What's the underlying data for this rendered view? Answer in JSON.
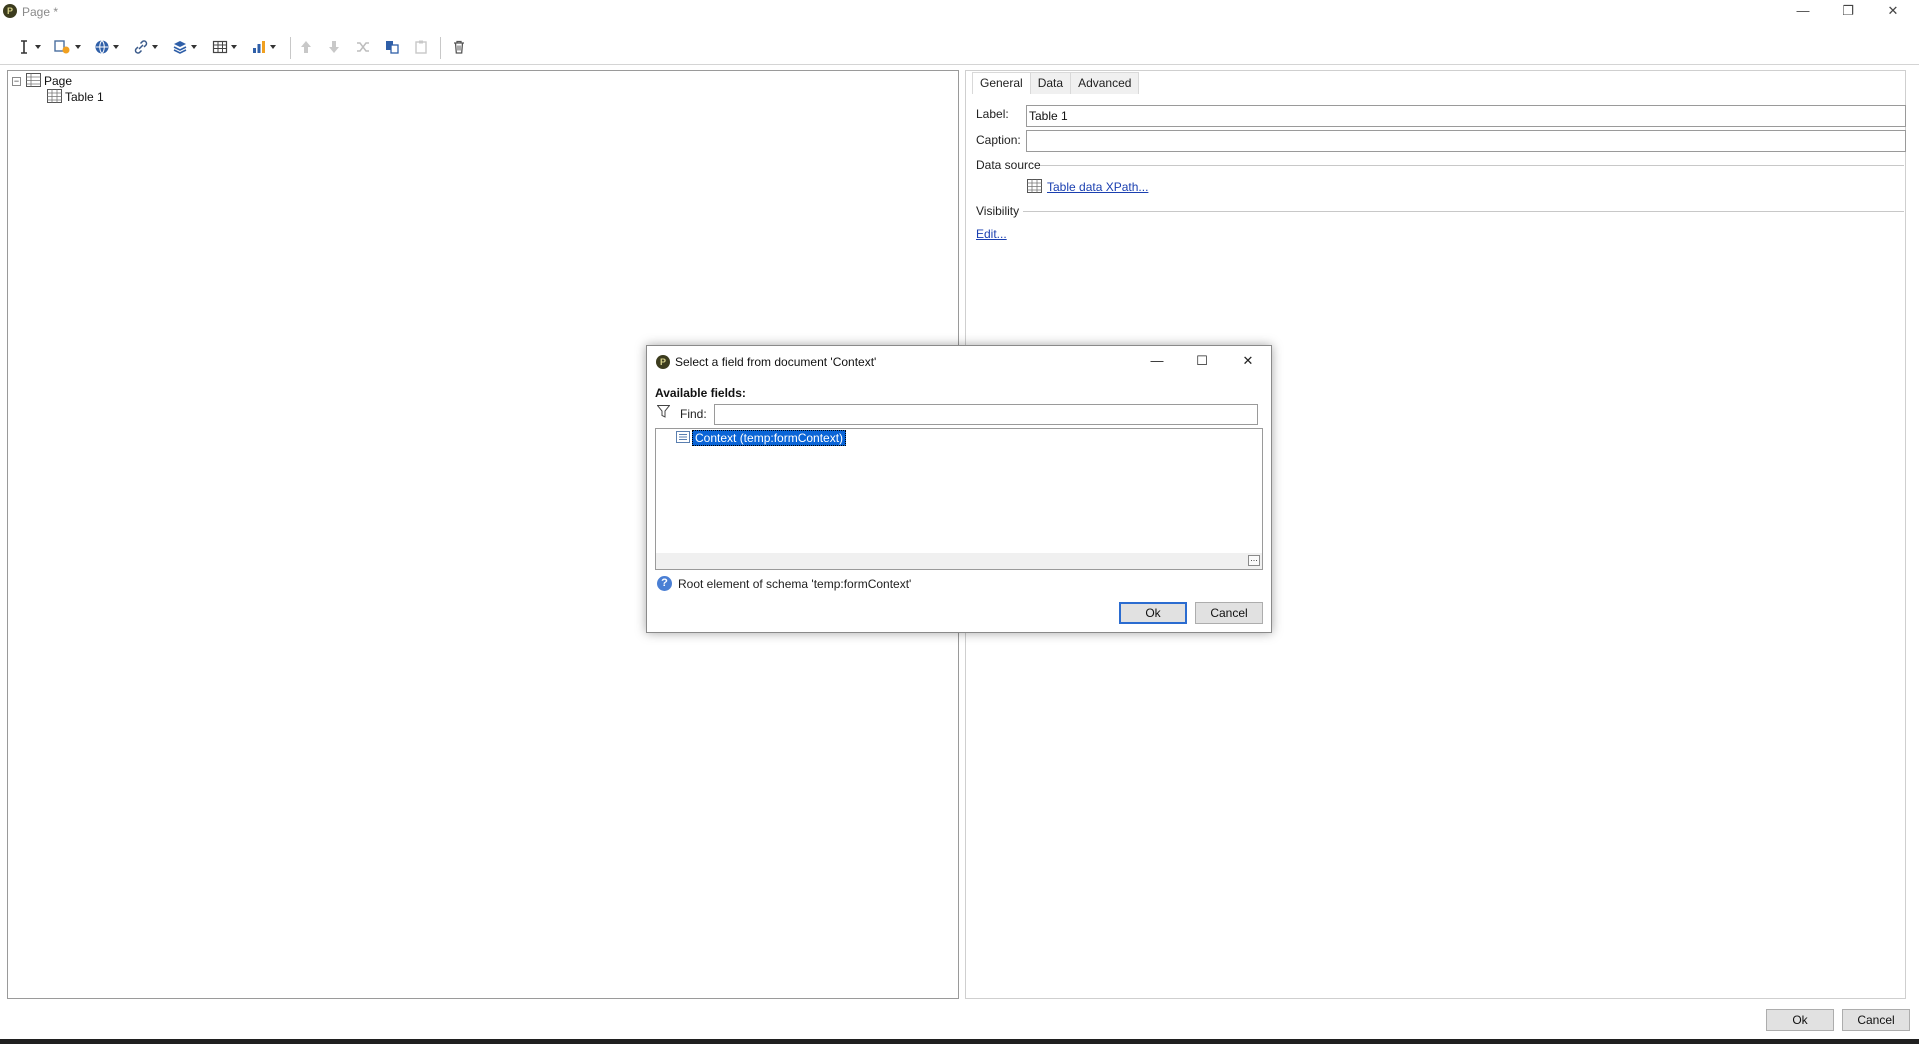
{
  "window": {
    "title": "Page *",
    "app_icon_glyph": "P",
    "controls": {
      "minimize": "—",
      "restore": "❐",
      "close": "✕"
    }
  },
  "toolbar": {
    "icons": [
      "insert-field-icon",
      "add-element-icon",
      "globe-icon",
      "link-icon",
      "stack-icon",
      "table-icon",
      "chart-icon",
      "move-up-icon",
      "move-down-icon",
      "shuffle-icon",
      "copy-icon",
      "paste-icon",
      "delete-icon"
    ]
  },
  "tree": {
    "root": {
      "label": "Page",
      "expander": "−"
    },
    "child": {
      "label": "Table 1"
    }
  },
  "properties": {
    "tabs": [
      {
        "label": "General",
        "active": true
      },
      {
        "label": "Data",
        "active": false
      },
      {
        "label": "Advanced",
        "active": false
      }
    ],
    "label_caption": "Label:",
    "label_value": "Table 1",
    "caption_caption": "Caption:",
    "caption_value": "",
    "data_source_heading": "Data source",
    "data_source_link": "Table data XPath...",
    "visibility_heading": "Visibility",
    "visibility_link": "Edit..."
  },
  "footer": {
    "ok_label": "Ok",
    "cancel_label": "Cancel"
  },
  "dialog": {
    "title": "Select a field from document 'Context'",
    "available_fields_label": "Available fields:",
    "find_label": "Find:",
    "find_value": "",
    "tree_item": "Context (temp:formContext)",
    "help_text": "Root element of schema 'temp:formContext'",
    "ok_label": "Ok",
    "cancel_label": "Cancel",
    "controls": {
      "minimize": "—",
      "maximize": "☐",
      "close": "✕"
    }
  },
  "colors": {
    "selection": "#0a64d6",
    "link": "#1a3fb0",
    "default_button_border": "#2b6cd0"
  }
}
